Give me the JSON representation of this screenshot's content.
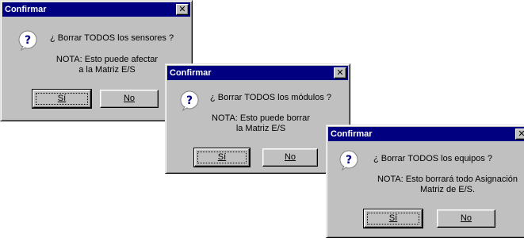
{
  "dialogs": [
    {
      "title": "Confirmar",
      "question": "¿ Borrar TODOS los sensores ?",
      "note_line1": "NOTA: Esto puede afectar",
      "note_line2": "a la Matriz E/S",
      "yes_label": "Sí",
      "no_label": "No"
    },
    {
      "title": "Confirmar",
      "question": "¿ Borrar TODOS los módulos ?",
      "note_line1": "NOTA: Esto puede borrar",
      "note_line2": "la Matriz E/S",
      "yes_label": "Sí",
      "no_label": "No"
    },
    {
      "title": "Confirmar",
      "question": "¿ Borrar TODOS los equipos ?",
      "note_line1": "NOTA: Esto borrará todo Asignación",
      "note_line2": "Matriz de E/S.",
      "yes_label": "Sí",
      "no_label": "No"
    }
  ],
  "close_glyph": "✕",
  "colors": {
    "titlebar": "#000080",
    "face": "#c0c0c0",
    "question_icon": "#ffffff",
    "question_mark": "#000080"
  },
  "icon": "question-icon"
}
